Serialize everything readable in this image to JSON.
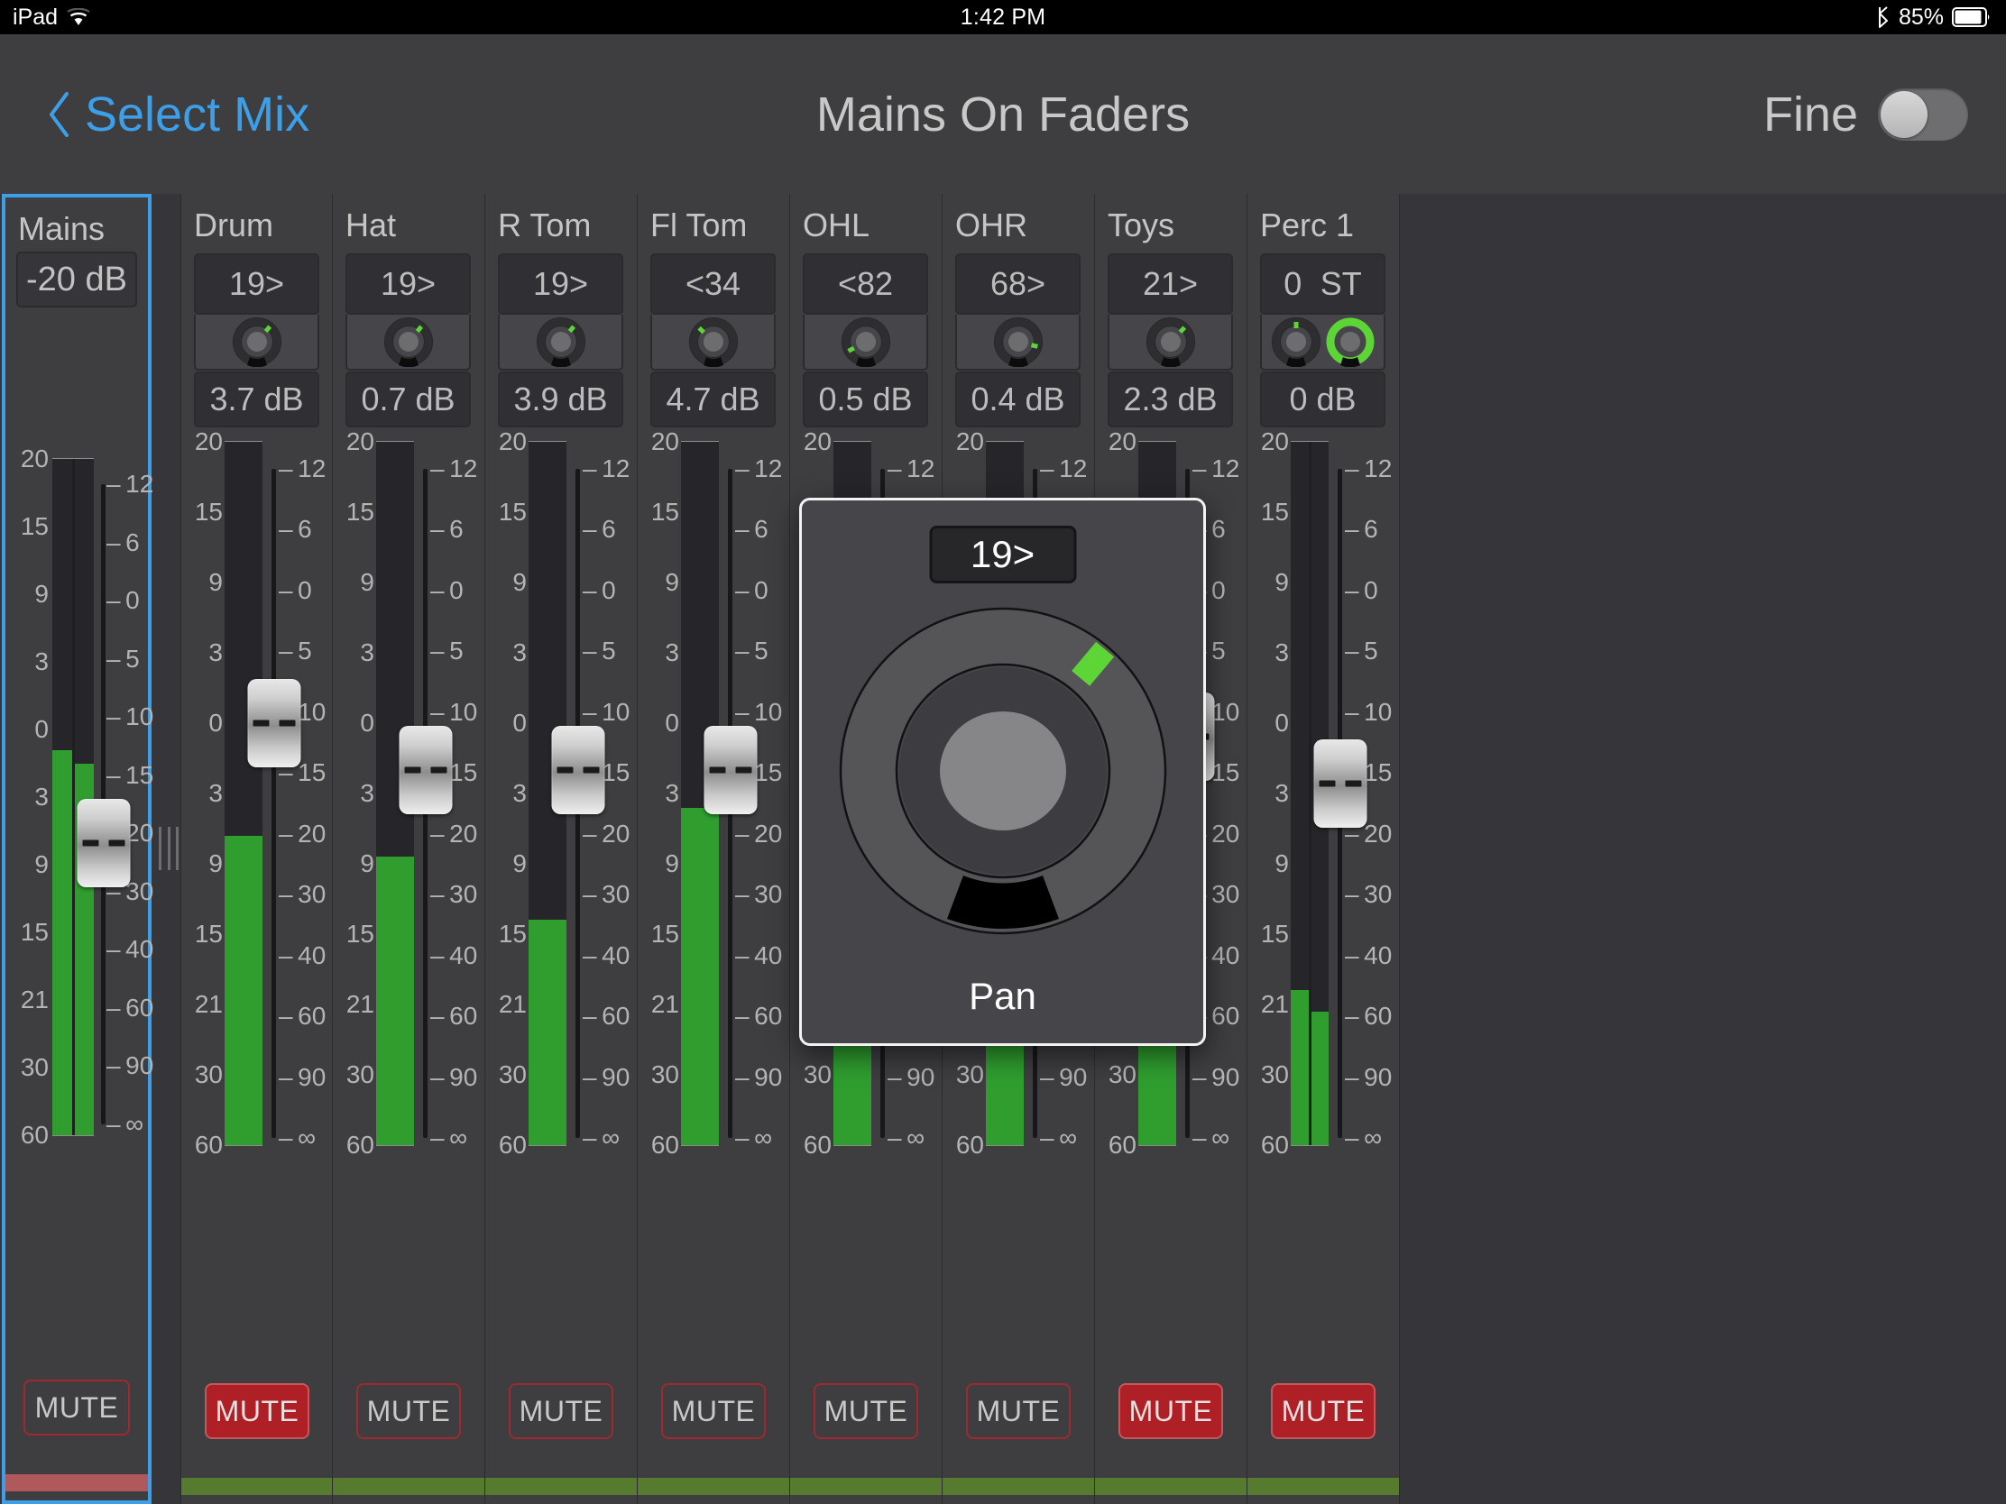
{
  "status_bar": {
    "carrier": "iPad",
    "wifi_icon": "wifi-icon",
    "time": "1:42 PM",
    "bluetooth_icon": "bluetooth-icon",
    "battery_pct": "85%",
    "battery_icon": "battery-icon"
  },
  "header": {
    "back_icon": "chevron-left-icon",
    "back_label": "Select Mix",
    "title": "Mains On Faders",
    "fine_label": "Fine",
    "fine_on": false
  },
  "colors": {
    "accent_blue": "#3c9fe8",
    "meter_green": "#2f9e2f",
    "knob_green": "#5ed536",
    "mute_active": "#ae2025",
    "mute_border": "#9e2a2f",
    "strip_mains": "#b0595c",
    "strip_channel": "#567a2e",
    "panel": "#3e3e41",
    "rail": "#35353a"
  },
  "meter_scale_left": [
    "20",
    "15",
    "9",
    "3",
    "0",
    "3",
    "9",
    "15",
    "21",
    "30",
    "60"
  ],
  "fader_scale_right": [
    "12",
    "6",
    "0",
    "5",
    "10",
    "15",
    "20",
    "30",
    "40",
    "60",
    "90",
    "∞"
  ],
  "mains": {
    "name": "Mains",
    "level_label": "-20 dB",
    "selected": true,
    "meter_left_pct": 57,
    "meter_right_pct": 55,
    "fader_pct": 44,
    "mute_label": "MUTE",
    "mute_active": false,
    "strip_color": "#b0595c"
  },
  "channels": [
    {
      "name": "Drum",
      "pan_label": "19>",
      "pan_angle": 40,
      "stereo": false,
      "level_label": "3.7 dB",
      "fader_pct": 62,
      "meter_pct": 44,
      "mute_label": "MUTE",
      "mute_active": true,
      "strip_color": "#567a2e"
    },
    {
      "name": "Hat",
      "pan_label": "19>",
      "pan_angle": 40,
      "stereo": false,
      "level_label": "0.7 dB",
      "fader_pct": 55,
      "meter_pct": 41,
      "mute_label": "MUTE",
      "mute_active": false,
      "strip_color": "#567a2e"
    },
    {
      "name": "R Tom",
      "pan_label": "19>",
      "pan_angle": 40,
      "stereo": false,
      "level_label": "3.9 dB",
      "fader_pct": 55,
      "meter_pct": 32,
      "mute_label": "MUTE",
      "mute_active": false,
      "strip_color": "#567a2e"
    },
    {
      "name": "Fl Tom",
      "pan_label": "<34",
      "pan_angle": -46,
      "stereo": false,
      "level_label": "4.7 dB",
      "fader_pct": 55,
      "meter_pct": 48,
      "mute_label": "MUTE",
      "mute_active": false,
      "strip_color": "#567a2e"
    },
    {
      "name": "OHL",
      "pan_label": "<82",
      "pan_angle": -118,
      "stereo": false,
      "level_label": "0.5 dB",
      "fader_pct": 55,
      "meter_pct": 46,
      "mute_label": "MUTE",
      "mute_active": false,
      "strip_color": "#567a2e"
    },
    {
      "name": "OHR",
      "pan_label": "68>",
      "pan_angle": 104,
      "stereo": false,
      "level_label": "0.4 dB",
      "fader_pct": 55,
      "meter_pct": 40,
      "mute_label": "MUTE",
      "mute_active": false,
      "strip_color": "#567a2e"
    },
    {
      "name": "Toys",
      "pan_label": "21>",
      "pan_angle": 44,
      "stereo": false,
      "level_label": "2.3 dB",
      "fader_pct": 60,
      "meter_pct": 20,
      "mute_label": "MUTE",
      "mute_active": true,
      "strip_color": "#567a2e"
    },
    {
      "name": "Perc 1",
      "pan_label": "0",
      "pan_label2": "ST",
      "pan_angle": 0,
      "stereo": true,
      "level_label": "0 dB",
      "fader_pct": 53,
      "meter_pct": 22,
      "meter_pct2": 19,
      "mute_label": "MUTE",
      "mute_active": true,
      "strip_color": "#567a2e"
    }
  ],
  "popup": {
    "value": "19>",
    "label": "Pan",
    "pan_angle": 40
  }
}
